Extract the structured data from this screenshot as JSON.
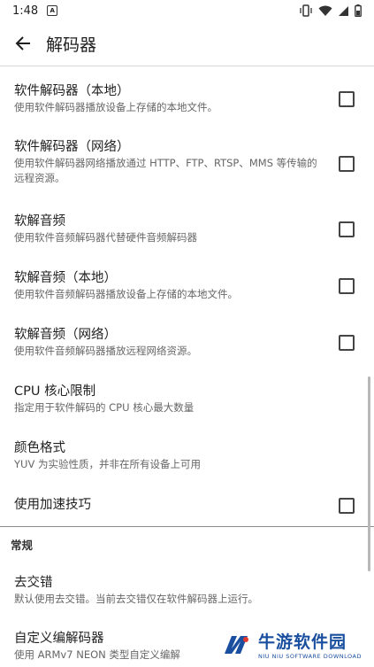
{
  "status_bar": {
    "time": "1:48",
    "notify_glyph": "A"
  },
  "app_bar": {
    "title": "解码器"
  },
  "settings": [
    {
      "title": "软件解码器（本地）",
      "subtitle": "使用软件解码器播放设备上存储的本地文件。",
      "checkbox": true,
      "checked": false
    },
    {
      "title": "软件解码器（网络）",
      "subtitle": "使用软件解码器网络播放通过 HTTP、FTP、RTSP、MMS 等传输的远程资源。",
      "checkbox": true,
      "checked": false
    },
    {
      "title": "软解音频",
      "subtitle": "使用软件音频解码器代替硬件音频解码器",
      "checkbox": true,
      "checked": false
    },
    {
      "title": "软解音频（本地）",
      "subtitle": "使用软件音频解码器播放设备上存储的本地文件。",
      "checkbox": true,
      "checked": false
    },
    {
      "title": "软解音频（网络）",
      "subtitle": "使用软件音频解码器播放远程网络资源。",
      "checkbox": true,
      "checked": false
    },
    {
      "title": "CPU 核心限制",
      "subtitle": "指定用于软件解码的 CPU 核心最大数量",
      "checkbox": false
    },
    {
      "title": "颜色格式",
      "subtitle": "YUV 为实验性质，并非在所有设备上可用",
      "checkbox": false
    },
    {
      "title": "使用加速技巧",
      "subtitle": "",
      "checkbox": true,
      "checked": false
    }
  ],
  "section": {
    "header": "常规"
  },
  "general": [
    {
      "title": "去交错",
      "subtitle": "默认使用去交错。当前去交错仅在软件解码器上运行。"
    },
    {
      "title": "自定义编解码器",
      "subtitle": "使用 ARMv7 NEON 类型自定义编解"
    }
  ],
  "watermark": {
    "cn": "牛游软件园",
    "en": "NIU NIU SOFTWARE DOWNLOAD"
  },
  "colors": {
    "text": "#1f1f1f",
    "subtext": "#666666",
    "brand": "#1a4fa0"
  }
}
